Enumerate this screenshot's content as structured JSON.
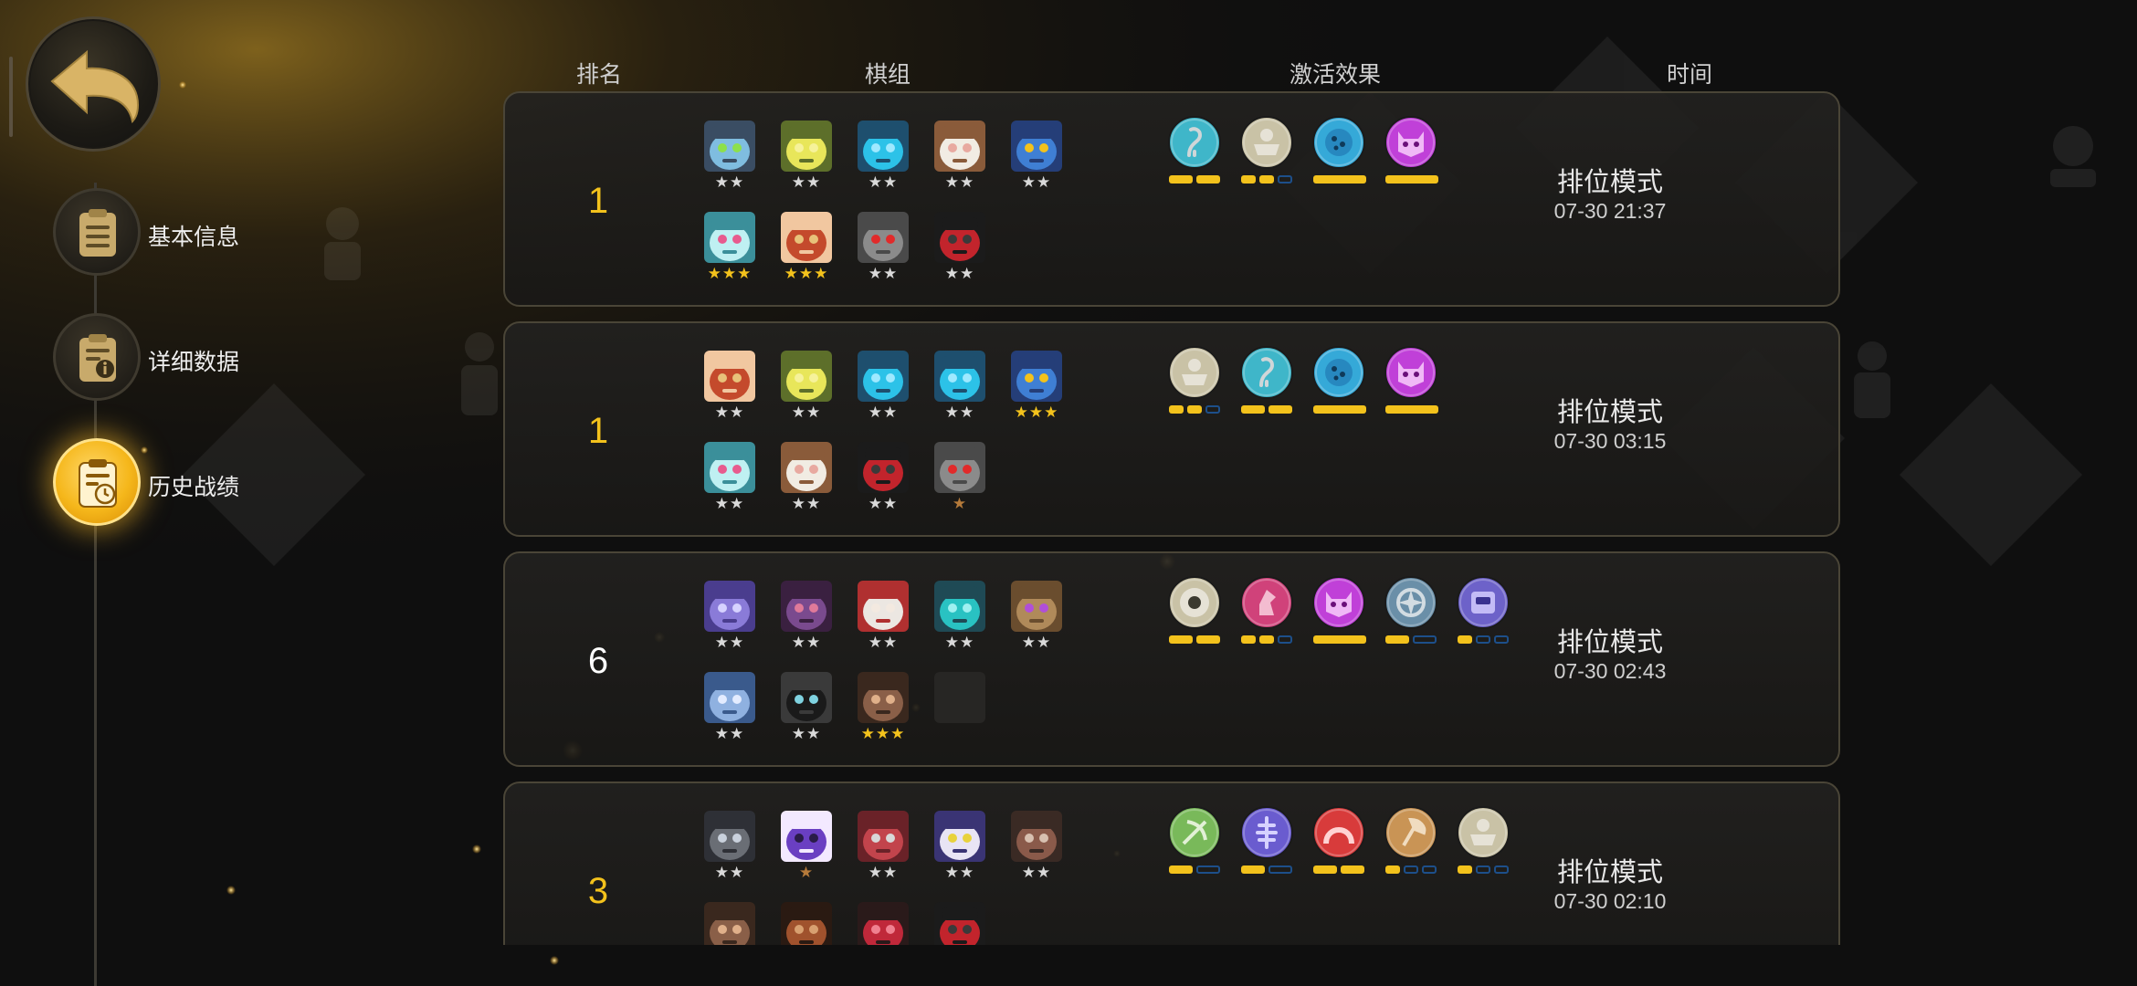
{
  "nav": {
    "items": [
      {
        "label": "基本信息",
        "icon": "notes-icon",
        "active": false
      },
      {
        "label": "详细数据",
        "icon": "data-info-icon",
        "active": false
      },
      {
        "label": "历史战绩",
        "icon": "history-icon",
        "active": true
      }
    ]
  },
  "header": {
    "rank": "排名",
    "lineup": "棋组",
    "synergy": "激活效果",
    "time": "时间"
  },
  "colors": {
    "accent_gold": "#f3c21c",
    "bar_off": "#1d4f8a"
  },
  "records": [
    {
      "rank": "1",
      "rank_highlight": true,
      "mode": "排位模式",
      "time": "07-30 21:37",
      "pieces": [
        {
          "stars": "★★",
          "level": 2,
          "style": "green-robot"
        },
        {
          "stars": "★★",
          "level": 2,
          "style": "yellow-owl"
        },
        {
          "stars": "★★",
          "level": 2,
          "style": "cyan-shield"
        },
        {
          "stars": "★★",
          "level": 2,
          "style": "white-sheep"
        },
        {
          "stars": "★★",
          "level": 2,
          "style": "blue-ogre"
        },
        {
          "stars": "★★★",
          "level": 3,
          "style": "ice-yeti"
        },
        {
          "stars": "★★★",
          "level": 3,
          "style": "red-hair-girl"
        },
        {
          "stars": "★★",
          "level": 2,
          "style": "grey-skull"
        },
        {
          "stars": "★★",
          "level": 2,
          "style": "red-hat-ninja"
        }
      ],
      "synergies": [
        {
          "icon": "hook-icon",
          "active": 2,
          "total": 2,
          "color": "#3fb6c9"
        },
        {
          "icon": "tub-icon",
          "active": 2,
          "total": 3,
          "color": "#c9c2a6"
        },
        {
          "icon": "cookie-icon",
          "active": 1,
          "total": 1,
          "color": "#35a9d8"
        },
        {
          "icon": "demon-icon",
          "active": 1,
          "total": 1,
          "color": "#c040d8"
        }
      ]
    },
    {
      "rank": "1",
      "rank_highlight": true,
      "mode": "排位模式",
      "time": "07-30 03:15",
      "pieces": [
        {
          "stars": "★★",
          "level": 2,
          "style": "red-hair-girl"
        },
        {
          "stars": "★★",
          "level": 2,
          "style": "yellow-owl"
        },
        {
          "stars": "★★",
          "level": 2,
          "style": "cyan-shield"
        },
        {
          "stars": "★★",
          "level": 2,
          "style": "cyan-shield"
        },
        {
          "stars": "★★★",
          "level": 3,
          "style": "blue-ogre"
        },
        {
          "stars": "★★",
          "level": 2,
          "style": "ice-yeti"
        },
        {
          "stars": "★★",
          "level": 2,
          "style": "white-sheep"
        },
        {
          "stars": "★★",
          "level": 2,
          "style": "red-hat-ninja"
        },
        {
          "stars": "★",
          "level": 1,
          "style": "grey-skull"
        }
      ],
      "synergies": [
        {
          "icon": "tub-icon",
          "active": 2,
          "total": 3,
          "color": "#c9c2a6"
        },
        {
          "icon": "hook-icon",
          "active": 2,
          "total": 2,
          "color": "#3fb6c9"
        },
        {
          "icon": "cookie-icon",
          "active": 1,
          "total": 1,
          "color": "#35a9d8"
        },
        {
          "icon": "demon-icon",
          "active": 1,
          "total": 1,
          "color": "#c040d8"
        }
      ]
    },
    {
      "rank": "6",
      "rank_highlight": false,
      "mode": "排位模式",
      "time": "07-30 02:43",
      "pieces": [
        {
          "stars": "★★",
          "level": 2,
          "style": "purple-mech"
        },
        {
          "stars": "★★",
          "level": 2,
          "style": "purple-bat"
        },
        {
          "stars": "★★",
          "level": 2,
          "style": "white-beast"
        },
        {
          "stars": "★★",
          "level": 2,
          "style": "teal-goggle"
        },
        {
          "stars": "★★",
          "level": 2,
          "style": "mummy"
        },
        {
          "stars": "★★",
          "level": 2,
          "style": "blue-knight"
        },
        {
          "stars": "★★",
          "level": 2,
          "style": "black-hood"
        },
        {
          "stars": "★★★",
          "level": 3,
          "style": "brown-hair"
        },
        {
          "stars": "",
          "level": 0,
          "style": "empty"
        }
      ],
      "synergies": [
        {
          "icon": "armor-icon",
          "active": 2,
          "total": 2,
          "color": "#c9c2a6"
        },
        {
          "icon": "knight-icon",
          "active": 2,
          "total": 3,
          "color": "#d0427a"
        },
        {
          "icon": "demon-icon",
          "active": 1,
          "total": 1,
          "color": "#c040d8"
        },
        {
          "icon": "shuriken-icon",
          "active": 1,
          "total": 2,
          "color": "#6a8fa8"
        },
        {
          "icon": "mech-icon",
          "active": 1,
          "total": 3,
          "color": "#6d62c9"
        }
      ]
    },
    {
      "rank": "3",
      "rank_highlight": true,
      "mode": "排位模式",
      "time": "07-30 02:10",
      "pieces": [
        {
          "stars": "★★",
          "level": 2,
          "style": "grey-mask"
        },
        {
          "stars": "★",
          "level": 1,
          "style": "purple-hair"
        },
        {
          "stars": "★★",
          "level": 2,
          "style": "red-helmet"
        },
        {
          "stars": "★★",
          "level": 2,
          "style": "glasses-bot"
        },
        {
          "stars": "★★",
          "level": 2,
          "style": "horn-demon"
        },
        {
          "stars": "",
          "level": 0,
          "style": "brown-hair"
        },
        {
          "stars": "",
          "level": 0,
          "style": "bandit"
        },
        {
          "stars": "",
          "level": 0,
          "style": "red-blob"
        },
        {
          "stars": "",
          "level": 0,
          "style": "red-hat-ninja"
        }
      ],
      "synergies": [
        {
          "icon": "bow-icon",
          "active": 1,
          "total": 2,
          "color": "#79b95a"
        },
        {
          "icon": "fishbone-icon",
          "active": 1,
          "total": 2,
          "color": "#6a5ccf"
        },
        {
          "icon": "arch-icon",
          "active": 2,
          "total": 2,
          "color": "#d83b3b"
        },
        {
          "icon": "axe-icon",
          "active": 1,
          "total": 3,
          "color": "#c99455"
        },
        {
          "icon": "tub-icon",
          "active": 1,
          "total": 3,
          "color": "#c9c2a6"
        }
      ]
    }
  ]
}
